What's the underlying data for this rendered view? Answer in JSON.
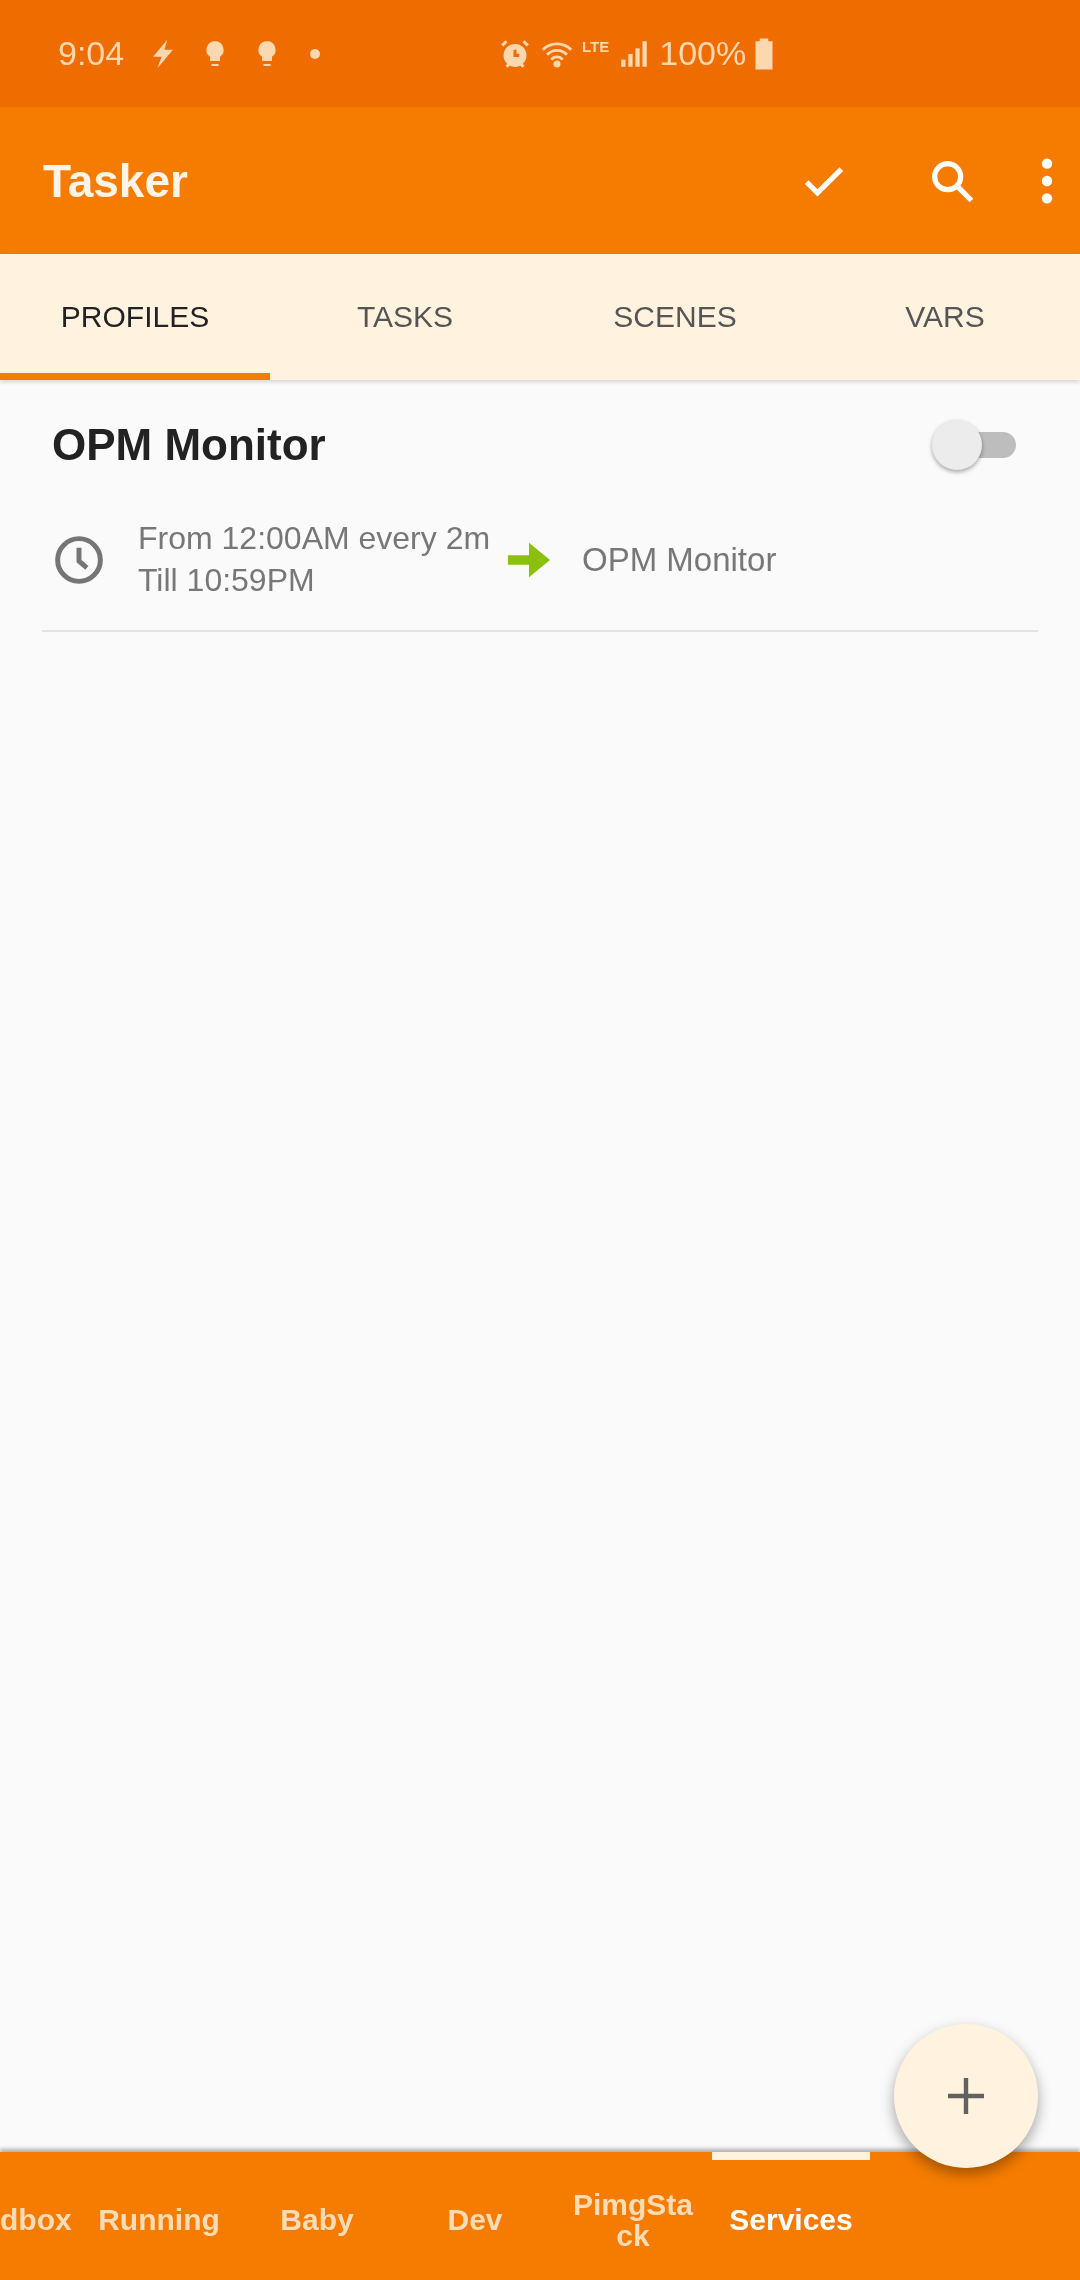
{
  "status_bar": {
    "time": "9:04",
    "network": "LTE",
    "battery": "100%"
  },
  "app_bar": {
    "title": "Tasker"
  },
  "tabs": [
    {
      "label": "PROFILES",
      "selected": true
    },
    {
      "label": "TASKS",
      "selected": false
    },
    {
      "label": "SCENES",
      "selected": false
    },
    {
      "label": "VARS",
      "selected": false
    }
  ],
  "profiles": [
    {
      "name": "OPM Monitor",
      "enabled": false,
      "context": "From 12:00AM every 2m Till 10:59PM",
      "task": "OPM Monitor"
    }
  ],
  "projects": [
    {
      "label": "dbox",
      "selected": false
    },
    {
      "label": "Running",
      "selected": false
    },
    {
      "label": "Baby",
      "selected": false
    },
    {
      "label": "Dev",
      "selected": false
    },
    {
      "label": "PimgStack",
      "selected": false
    },
    {
      "label": "Services",
      "selected": true
    }
  ]
}
